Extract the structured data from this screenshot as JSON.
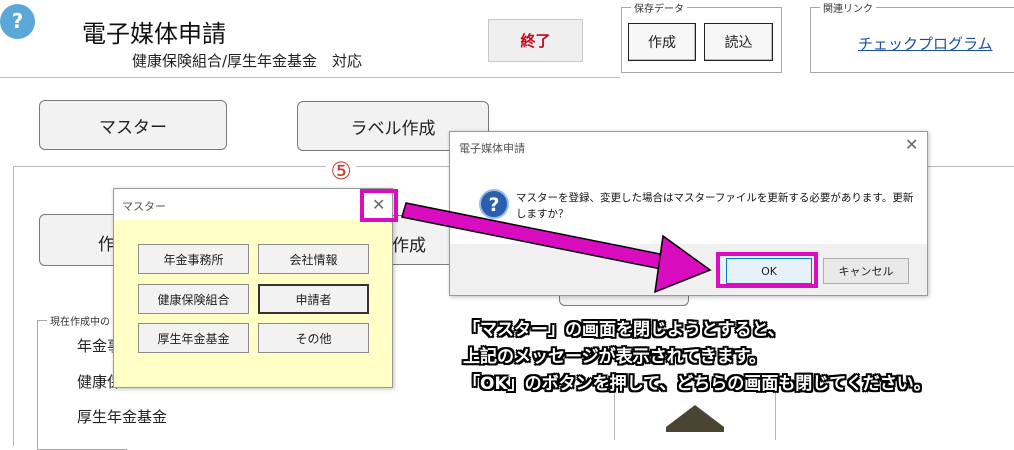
{
  "header": {
    "help_icon_glyph": "?",
    "title": "電子媒体申請",
    "subtitle": "健康保険組合/厚生年金基金　対応",
    "exit_label": "終了",
    "save_group": {
      "caption": "保存データ",
      "create_label": "作成",
      "load_label": "読込"
    },
    "related_group": {
      "caption": "関連リンク",
      "link_label": "チェックプログラム"
    }
  },
  "main": {
    "master_button_label": "マスター",
    "label_button_label": "ラベル作成",
    "create_button_partial": "作",
    "create_button_tail": "作成",
    "current_group_caption": "現在作成中の",
    "left_items": [
      "年金事",
      "健康保",
      "厚生年金基金"
    ]
  },
  "confirm_dialog": {
    "title": "電子媒体申請",
    "message_line1": "マスターを登録、変更した場合はマスターファイルを更新する必要があります。更新",
    "message_line2": "しますか？",
    "ok_label": "OK",
    "cancel_label": "キャンセル"
  },
  "master_dialog": {
    "title": "マスター",
    "buttons": [
      "年金事務所",
      "会社情報",
      "健康保険組合",
      "申請者",
      "厚生年金基金",
      "その他"
    ]
  },
  "annotation": {
    "step_number": "⑤",
    "highlight_color": "#d90dbf",
    "lines": [
      "「マスター」の画面を閉じようとすると、",
      "上記のメッセージが表示されてきます。",
      "「OK」のボタンを押して、どちらの画面も閉じてください。"
    ]
  }
}
